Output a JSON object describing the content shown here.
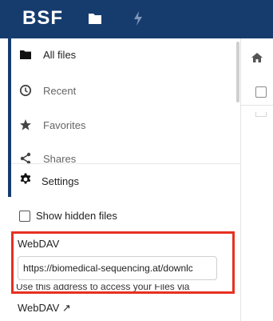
{
  "header": {
    "logo": "BSF",
    "bg_color": "#163c6e",
    "icons": [
      "folder-icon",
      "bolt-icon"
    ]
  },
  "sidebar": {
    "items": [
      {
        "label": "All files",
        "icon": "folder-icon",
        "active": true
      },
      {
        "label": "Recent",
        "icon": "clock-icon"
      },
      {
        "label": "Favorites",
        "icon": "star-icon"
      },
      {
        "label": "Shares",
        "icon": "share-icon"
      }
    ]
  },
  "settings": {
    "label": "Settings",
    "show_hidden_label": "Show hidden files",
    "show_hidden_checked": false,
    "webdav_title": "WebDAV",
    "webdav_url": "https://biomedical-sequencing.at/downlc",
    "webdav_hint": "Use this address to access your Files via",
    "webdav_link": "WebDAV ↗",
    "highlight_color": "#e63121"
  }
}
